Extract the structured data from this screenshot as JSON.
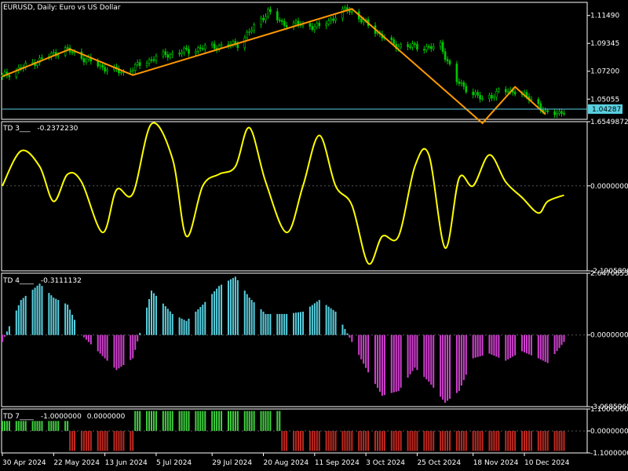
{
  "chart_data": [
    {
      "panel": "price",
      "type": "line",
      "title": "EURUSD, Daily: Euro vs US Dollar",
      "y_ticks": [
        "1.11490",
        "1.09345",
        "1.07200",
        "1.05055"
      ],
      "current_price": "1.04287",
      "ylim": [
        1.035,
        1.125
      ],
      "x": [
        "30 Apr",
        "15 May",
        "27 May",
        "12 Jun",
        "21 Jun",
        "5 Jul",
        "25 Jul",
        "9 Aug",
        "15 Aug",
        "22 Aug",
        "28 Aug",
        "5 Sep",
        "13 Sep",
        "25 Sep",
        "15 Oct",
        "1 Nov",
        "4 Nov",
        "11 Nov",
        "22 Nov",
        "29 Nov",
        "6 Dec",
        "16 Dec",
        "19 Dec",
        "27 Dec"
      ],
      "values": [
        1.068,
        1.08,
        1.089,
        1.075,
        1.071,
        1.083,
        1.09,
        1.093,
        1.104,
        1.118,
        1.109,
        1.108,
        1.106,
        1.12,
        1.092,
        1.09,
        1.092,
        1.064,
        1.05,
        1.056,
        1.057,
        1.047,
        1.039,
        1.041
      ],
      "zigzag_x": [
        "30 Apr",
        "29 May",
        "25 Jun",
        "27 Sep",
        "22 Nov",
        "6 Dec",
        "19 Dec"
      ],
      "zigzag_values": [
        1.068,
        1.089,
        1.069,
        1.12,
        1.032,
        1.06,
        1.039
      ],
      "colors": {
        "candles": "#00c800",
        "zigzag": "#ff9900",
        "price_line": "#59d0e0"
      }
    },
    {
      "panel": "td3",
      "type": "line",
      "header": "TD 3___",
      "header_value": "-0.2372230",
      "y_ticks": [
        "1.6549872",
        "0.0000000",
        "-2.1905890"
      ],
      "ylim": [
        -2.190589,
        1.6549872
      ],
      "x": [
        "30 Apr",
        "8 May",
        "16 May",
        "22 May",
        "28 May",
        "3 Jun",
        "12 Jun",
        "18 Jun",
        "25 Jun",
        "3 Jul",
        "12 Jul",
        "18 Jul",
        "25 Jul",
        "1 Aug",
        "8 Aug",
        "14 Aug",
        "21 Aug",
        "30 Aug",
        "6 Sep",
        "13 Sep",
        "20 Sep",
        "27 Sep",
        "4 Oct",
        "10 Oct",
        "17 Oct",
        "24 Oct",
        "30 Oct",
        "6 Nov",
        "12 Nov",
        "18 Nov",
        "25 Nov",
        "2 Dec",
        "9 Dec",
        "16 Dec",
        "20 Dec",
        "27 Dec"
      ],
      "values": [
        0.0,
        0.9,
        0.5,
        -0.4,
        0.3,
        0.1,
        -1.2,
        -0.1,
        -0.2,
        1.6,
        0.7,
        -1.3,
        0.0,
        0.3,
        0.5,
        1.5,
        0.1,
        -1.2,
        0.0,
        1.3,
        0.0,
        -0.5,
        -2.0,
        -1.3,
        -1.3,
        0.5,
        0.8,
        -1.6,
        0.2,
        0.0,
        0.8,
        0.1,
        -0.3,
        -0.7,
        -0.4,
        -0.24
      ],
      "color": "#ffff00"
    },
    {
      "panel": "td4",
      "type": "bar",
      "header": "TD 4____",
      "header_value": "-0.3111132",
      "y_ticks": [
        "2.6470653",
        "0.0000000",
        "-3.0685965"
      ],
      "ylim": [
        -3.0685965,
        2.6470653
      ],
      "x": [
        "30 Apr",
        "8 May",
        "16 May",
        "22 May",
        "28 May",
        "3 Jun",
        "12 Jun",
        "18 Jun",
        "25 Jun",
        "3 Jul",
        "12 Jul",
        "18 Jul",
        "25 Jul",
        "1 Aug",
        "8 Aug",
        "14 Aug",
        "21 Aug",
        "30 Aug",
        "6 Sep",
        "13 Sep",
        "20 Sep",
        "27 Sep",
        "4 Oct",
        "10 Oct",
        "17 Oct",
        "24 Oct",
        "30 Oct",
        "6 Nov",
        "12 Nov",
        "18 Nov",
        "25 Nov",
        "2 Dec",
        "9 Dec",
        "16 Dec",
        "20 Dec",
        "27 Dec"
      ],
      "values": [
        -0.3,
        1.5,
        2.2,
        1.6,
        1.3,
        0.0,
        -0.9,
        -1.5,
        -1.0,
        1.9,
        0.9,
        0.6,
        1.3,
        2.1,
        2.5,
        1.6,
        0.9,
        0.9,
        1.0,
        1.5,
        1.0,
        -0.3,
        -1.6,
        -2.6,
        -2.4,
        -1.4,
        -2.0,
        -2.9,
        -2.4,
        -1.0,
        -0.8,
        -1.1,
        -0.7,
        -1.0,
        -1.2,
        -0.3
      ],
      "colors": {
        "positive": "#59d0e0",
        "negative": "#d040d0"
      }
    },
    {
      "panel": "td7",
      "type": "bar",
      "header": "TD 7____",
      "header_values": [
        "-1.0000000",
        "0.0000000"
      ],
      "y_ticks": [
        "1.1000000",
        "0.0000000",
        "-1.1000000"
      ],
      "ylim": [
        -1.1,
        1.1
      ],
      "x": [
        "30 Apr",
        "29 May",
        "26 Jun",
        "28 Aug",
        "27 Dec"
      ],
      "values": [
        0.5,
        -1.0,
        1.0,
        -1.0,
        -1.0
      ],
      "colors": {
        "positive": "#40d040",
        "negative": "#c02820"
      }
    }
  ],
  "x_axis_labels": [
    "30 Apr 2024",
    "22 May 2024",
    "13 Jun 2024",
    "5 Jul 2024",
    "29 Jul 2024",
    "20 Aug 2024",
    "11 Sep 2024",
    "3 Oct 2024",
    "25 Oct 2024",
    "18 Nov 2024",
    "10 Dec 2024"
  ]
}
